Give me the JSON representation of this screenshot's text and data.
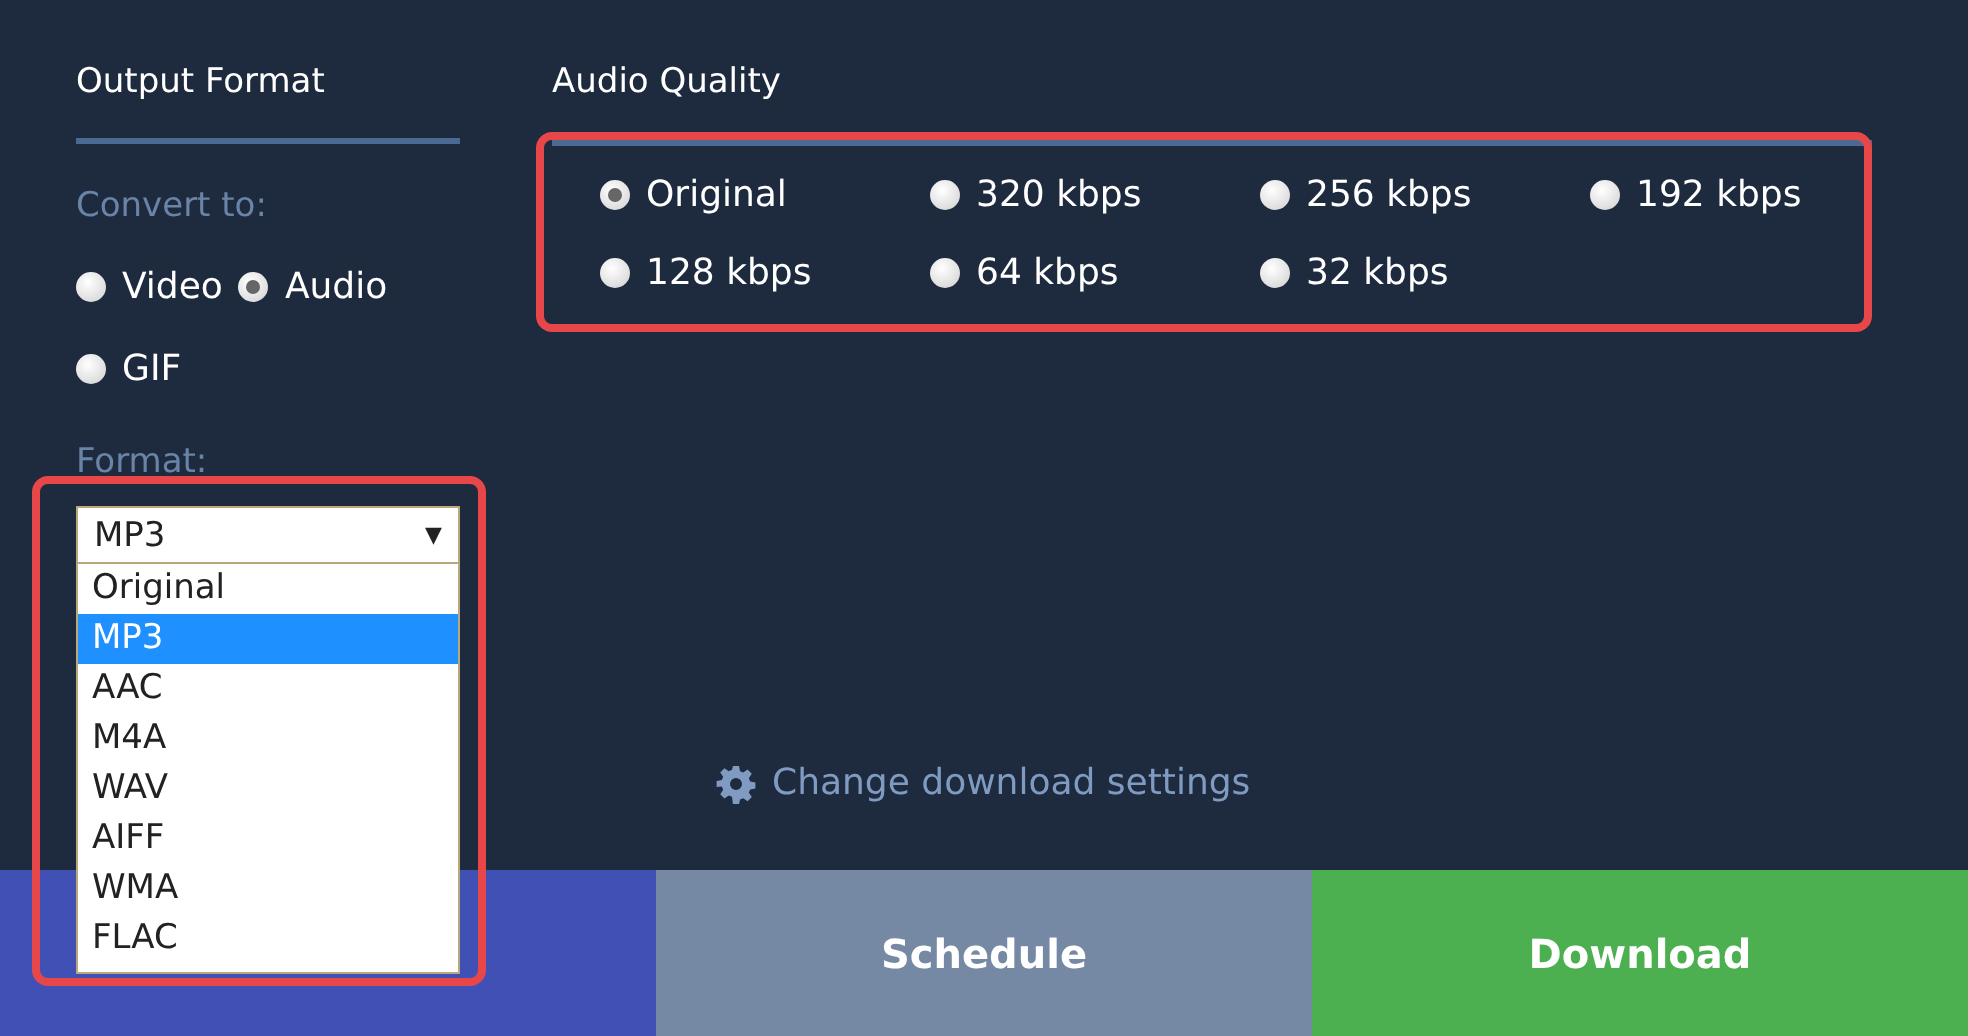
{
  "output_format": {
    "title": "Output Format",
    "convert_label": "Convert to:",
    "convert_options": [
      {
        "label": "Video",
        "selected": false
      },
      {
        "label": "Audio",
        "selected": true
      },
      {
        "label": "GIF",
        "selected": false
      }
    ],
    "format_label": "Format:",
    "format_select": {
      "value": "MP3",
      "arrow": "▼",
      "expanded": true,
      "highlighted": true,
      "options": [
        {
          "label": "Original",
          "selected": false
        },
        {
          "label": "MP3",
          "selected": true
        },
        {
          "label": "AAC",
          "selected": false
        },
        {
          "label": "M4A",
          "selected": false
        },
        {
          "label": "WAV",
          "selected": false
        },
        {
          "label": "AIFF",
          "selected": false
        },
        {
          "label": "WMA",
          "selected": false
        },
        {
          "label": "FLAC",
          "selected": false
        }
      ]
    }
  },
  "audio_quality": {
    "title": "Audio Quality",
    "highlighted": true,
    "options": [
      {
        "label": "Original",
        "selected": true
      },
      {
        "label": "320 kbps",
        "selected": false
      },
      {
        "label": "256 kbps",
        "selected": false
      },
      {
        "label": "192 kbps",
        "selected": false
      },
      {
        "label": "128 kbps",
        "selected": false
      },
      {
        "label": "64 kbps",
        "selected": false
      },
      {
        "label": "32 kbps",
        "selected": false
      }
    ]
  },
  "settings_link": "Change download settings",
  "buttons": [
    {
      "color": "#4150b5"
    },
    {
      "label": "Schedule",
      "color": "#7689a4"
    },
    {
      "label": "Download",
      "color": "#4caf50"
    }
  ]
}
